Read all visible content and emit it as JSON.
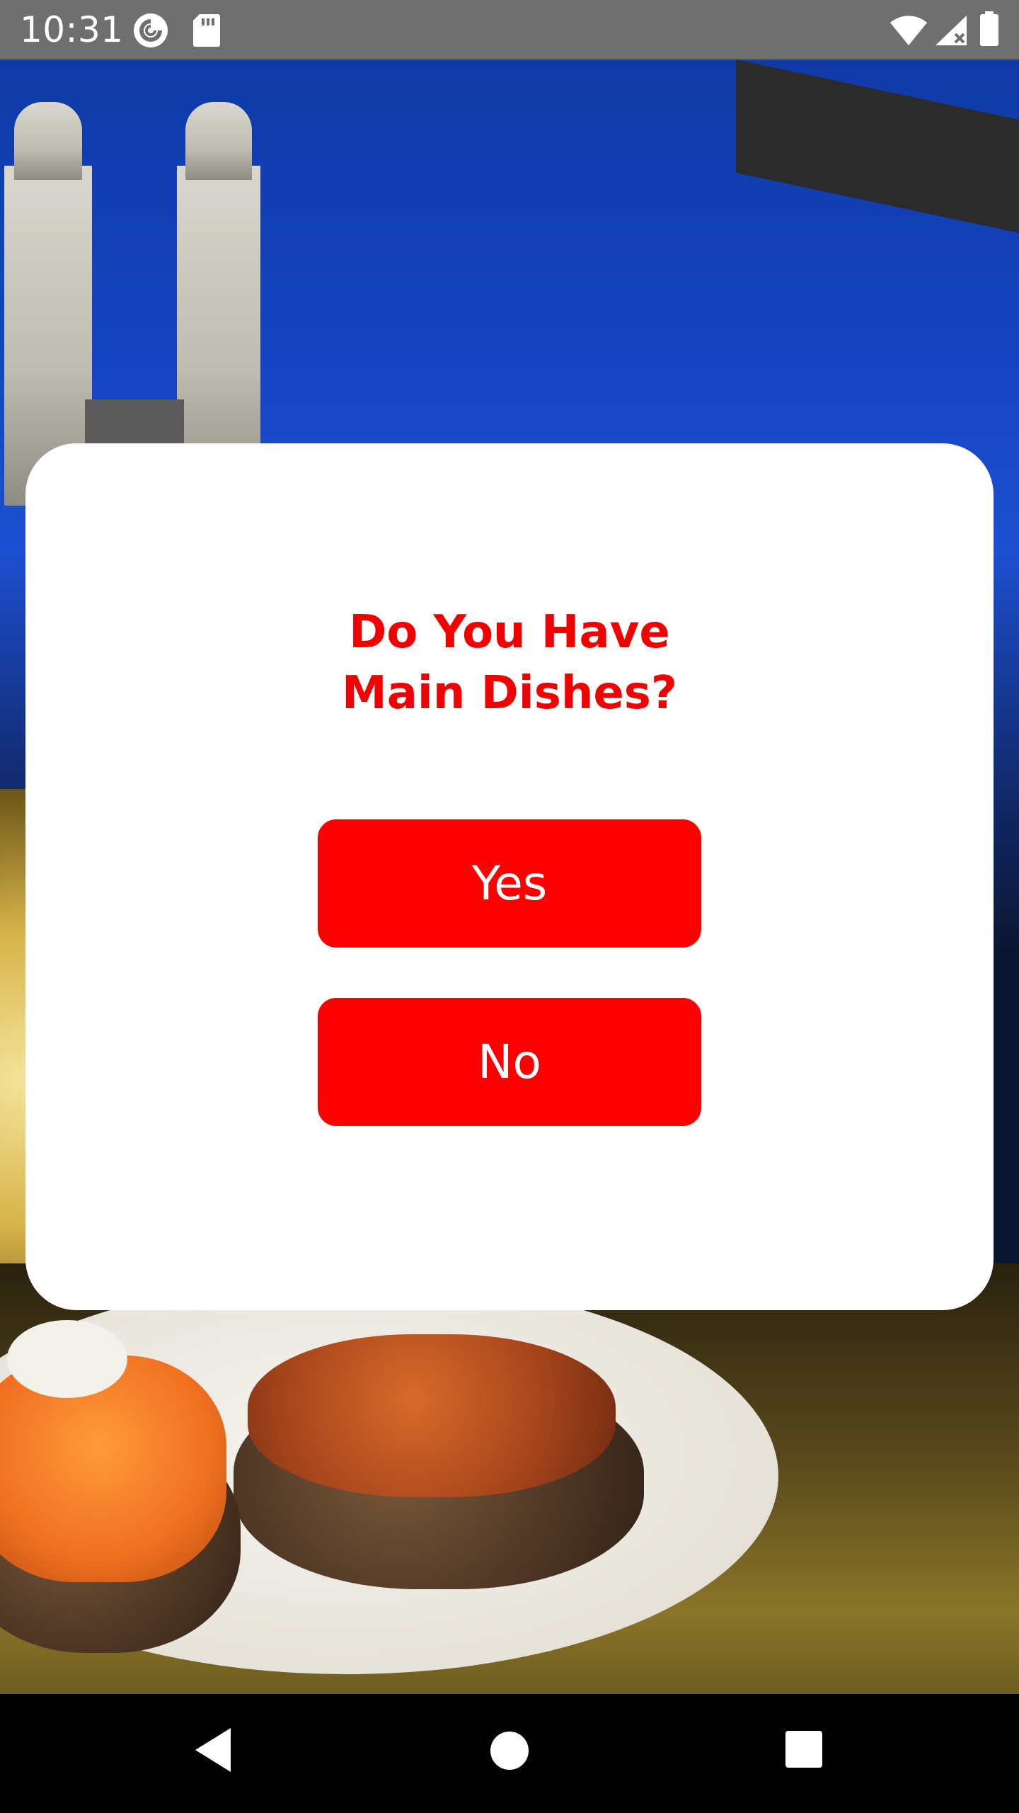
{
  "status_bar": {
    "time": "10:31",
    "left_icons": [
      "pocket-casts-icon",
      "sd-card-icon"
    ],
    "right_icons": [
      "wifi-icon",
      "cellular-signal-icon",
      "battery-icon"
    ]
  },
  "background": {
    "description_icon": "photo-background"
  },
  "dialog": {
    "title": "Do You Have\nMain Dishes?",
    "yes_label": "Yes",
    "no_label": "No",
    "accent_color": "#ff0000"
  },
  "nav_bar": {
    "items": [
      "back-icon",
      "home-icon",
      "recents-icon"
    ]
  }
}
